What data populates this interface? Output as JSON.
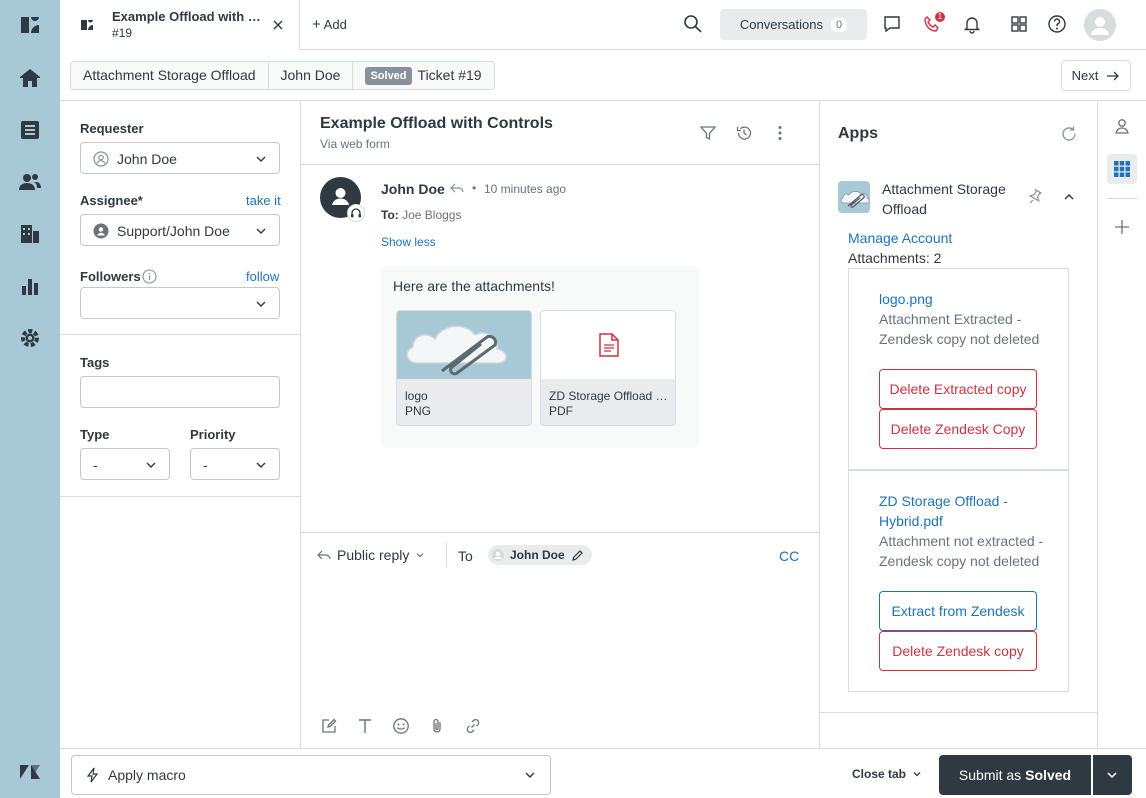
{
  "tab": {
    "title": "Example Offload with Controls",
    "subtitle": "#19"
  },
  "topbar": {
    "add_label": "Add",
    "conversations_label": "Conversations",
    "conversations_count": "0",
    "talk_badge": "1"
  },
  "breadcrumb": {
    "items": [
      "Attachment Storage Offload",
      "John Doe"
    ],
    "status": "Solved",
    "ticket": "Ticket #19",
    "next_label": "Next"
  },
  "properties": {
    "requester_label": "Requester",
    "requester_value": "John Doe",
    "assignee_label": "Assignee*",
    "assignee_link": "take it",
    "assignee_value": "Support/John Doe",
    "followers_label": "Followers",
    "followers_link": "follow",
    "tags_label": "Tags",
    "type_label": "Type",
    "type_value": "-",
    "priority_label": "Priority",
    "priority_value": "-"
  },
  "ticket": {
    "subject": "Example Offload with Controls",
    "via": "Via web form",
    "author": "John Doe",
    "time_ago": "10 minutes ago",
    "to_prefix": "To:",
    "to_name": "Joe Bloggs",
    "show_less": "Show less",
    "body": "Here are the attachments!",
    "attachments": [
      {
        "name": "logo",
        "type": "PNG"
      },
      {
        "name": "ZD Storage Offload - Hybrid",
        "type": "PDF"
      }
    ]
  },
  "composer": {
    "reply_type": "Public reply",
    "to_label": "To",
    "recipient": "John Doe",
    "cc_label": "CC"
  },
  "apps": {
    "title": "Apps",
    "app_name": "Attachment Storage Offload",
    "manage_link": "Manage Account",
    "attachments_count": "Attachments: 2",
    "cards": [
      {
        "file": "logo.png",
        "status": "Attachment Extracted - Zendesk copy not deleted",
        "button1": "Delete Extracted copy",
        "button2": "Delete Zendesk Copy"
      },
      {
        "file": "ZD Storage Offload - Hybrid.pdf",
        "status": "Attachment not extracted - Zendesk copy not deleted",
        "button1": "Extract from Zendesk",
        "button2": "Delete Zendesk copy"
      }
    ]
  },
  "bottombar": {
    "macro_label": "Apply macro",
    "close_tab": "Close tab",
    "submit_prefix": "Submit as",
    "submit_status": "Solved"
  },
  "colors": {
    "nav": "#a7c8d5",
    "link": "#1f73b7",
    "danger": "#cc3340",
    "dark": "#2f3941"
  }
}
